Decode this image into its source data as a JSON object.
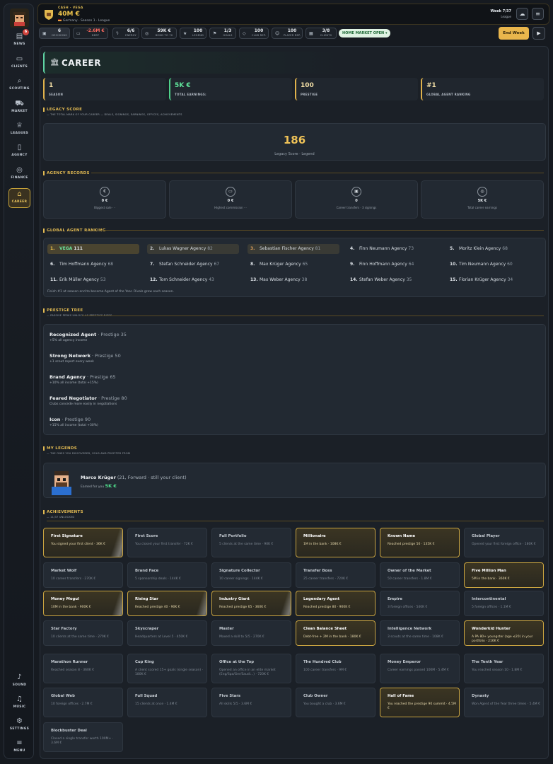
{
  "sidebar": {
    "items": [
      {
        "label": "NEWS",
        "icon": "newspaper-icon",
        "badge": "6"
      },
      {
        "label": "CLIENTS",
        "icon": "briefcase-icon"
      },
      {
        "label": "SCOUTING",
        "icon": "search-icon"
      },
      {
        "label": "MARKET",
        "icon": "cart-icon"
      },
      {
        "label": "LEAGUES",
        "icon": "trophy-icon"
      },
      {
        "label": "AGENCY",
        "icon": "document-icon"
      },
      {
        "label": "FINANCE",
        "icon": "coins-icon"
      },
      {
        "label": "CAREER",
        "icon": "bank-icon"
      }
    ],
    "bottom": [
      {
        "label": "SOUND",
        "icon": "speaker-icon"
      },
      {
        "label": "MUSIC",
        "icon": "music-icon"
      },
      {
        "label": "SETTINGS",
        "icon": "gear-icon"
      },
      {
        "label": "MENU",
        "icon": "menu-icon"
      }
    ]
  },
  "topbar": {
    "cash_label": "CASH · VEGA",
    "cash": "40M €",
    "sub": "Germany · Season 1 · League",
    "week": "Week 7/37",
    "week_sub": "League"
  },
  "stats": [
    {
      "value": "6",
      "label": "DECISIONS",
      "icon": "inbox-icon"
    },
    {
      "value": "-2.6M €",
      "label": "DEBT",
      "icon": "wallet-icon"
    },
    {
      "value": "6/6",
      "label": "ENERGY",
      "icon": "bolt-icon"
    },
    {
      "value": "59K €",
      "label": "BOND TO 70",
      "icon": "target-icon"
    },
    {
      "value": "100",
      "label": "LEGEND",
      "icon": "star-icon"
    },
    {
      "value": "1/3",
      "label": "GOALS",
      "icon": "flag-icon"
    },
    {
      "value": "100",
      "label": "CLUB REP.",
      "icon": "shield-icon"
    },
    {
      "value": "100",
      "label": "PLAYER REP.",
      "icon": "person-icon"
    },
    {
      "value": "3/8",
      "label": "CLIENTS",
      "icon": "clients-icon"
    }
  ],
  "market_pill": "HOME MARKET OPEN ▾",
  "end_week": "End Week",
  "career": {
    "title": "CAREER",
    "cards": [
      {
        "value": "1",
        "label": "SEASON"
      },
      {
        "value": "5K €",
        "label": "TOTAL EARNINGS:"
      },
      {
        "value": "100",
        "label": "PRESTIGE"
      },
      {
        "value": "#1",
        "label": "GLOBAL AGENT RANKING"
      }
    ],
    "legacy": {
      "title": "LEGACY SCORE",
      "subtitle": "— THE TOTAL MARK OF YOUR CAREER — DEALS, SIGNINGS, EARNINGS, OFFICES, ACHIEVEMENTS",
      "value": "186",
      "label": "Legacy Score · Legend"
    },
    "records": {
      "title": "AGENCY RECORDS",
      "items": [
        {
          "value": "0 €",
          "label": "Biggest sale · -",
          "icon": "€"
        },
        {
          "value": "0 €",
          "label": "Highest commission · -",
          "icon": "▭"
        },
        {
          "value": "0",
          "label": "Career transfers · 3 signings",
          "icon": "▣"
        },
        {
          "value": "5K €",
          "label": "Total career earnings",
          "icon": "◎"
        }
      ]
    },
    "ranking": {
      "title": "GLOBAL AGENT RANKING",
      "note": "Finish #1 at season end to become Agent of the Year. Rivals grow each season.",
      "rows": [
        [
          {
            "rank": "1.",
            "name": "VEGA",
            "score": "111"
          },
          {
            "rank": "2.",
            "name": "Lukas Wagner Agency",
            "score": "82"
          },
          {
            "rank": "3.",
            "name": "Sebastian Fischer Agency",
            "score": "81"
          },
          {
            "rank": "4.",
            "name": "Finn Neumann Agency",
            "score": "73"
          },
          {
            "rank": "5.",
            "name": "Moritz Klein Agency",
            "score": "68"
          }
        ],
        [
          {
            "rank": "6.",
            "name": "Tim Hoffmann Agency",
            "score": "68"
          },
          {
            "rank": "7.",
            "name": "Stefan Schneider Agency",
            "score": "67"
          },
          {
            "rank": "8.",
            "name": "Max Krüger Agency",
            "score": "65"
          },
          {
            "rank": "9.",
            "name": "Finn Hoffmann Agency",
            "score": "64"
          },
          {
            "rank": "10.",
            "name": "Tim Neumann Agency",
            "score": "60"
          }
        ],
        [
          {
            "rank": "11.",
            "name": "Erik Müller Agency",
            "score": "53"
          },
          {
            "rank": "12.",
            "name": "Tom Schneider Agency",
            "score": "43"
          },
          {
            "rank": "13.",
            "name": "Max Weber Agency",
            "score": "38"
          },
          {
            "rank": "14.",
            "name": "Stefan Weber Agency",
            "score": "35"
          },
          {
            "rank": "15.",
            "name": "Florian Krüger Agency",
            "score": "34"
          }
        ]
      ]
    },
    "prestige": {
      "title": "PRESTIGE TREE",
      "subtitle": "— PASSIVE PERKS UNLOCK AS PRESTIGE RISES",
      "tiers": [
        {
          "name": "Recognized Agent",
          "req": " · Prestige 35",
          "perk": "+5% all agency income"
        },
        {
          "name": "Strong Network",
          "req": " · Prestige 50",
          "perk": "+1 scout report every week"
        },
        {
          "name": "Brand Agency",
          "req": " · Prestige 65",
          "perk": "+10% all income (total +15%)"
        },
        {
          "name": "Feared Negotiator",
          "req": " · Prestige 80",
          "perk": "Clubs concede more easily in negotiations"
        },
        {
          "name": "Icon",
          "req": " · Prestige 90",
          "perk": "+15% all income (total +30%)"
        }
      ]
    },
    "legends": {
      "title": "MY LEGENDS",
      "subtitle": "— THE ONES YOU DISCOVERED, SOLD AND PROFITED FROM",
      "name": "Marco Krüger",
      "detail": " (21, Forward · still your client)",
      "earned_label": "Earned for you",
      "earned": "5K €"
    },
    "achievements": {
      "title": "ACHIEVEMENTS",
      "subtitle": "— 11/37 UNLOCKED",
      "items": [
        {
          "t": "First Signature",
          "d": "You signed your first client · 36K €",
          "on": true,
          "shine": true
        },
        {
          "t": "First Score",
          "d": "You closed your first transfer · 72K €",
          "on": false
        },
        {
          "t": "Full Portfolio",
          "d": "5 clients at the same time · 90K €",
          "on": false
        },
        {
          "t": "Millionaire",
          "d": "1M in the bank · 108K €",
          "on": true
        },
        {
          "t": "Known Name",
          "d": "Reached prestige 50 · 135K €",
          "on": true
        },
        {
          "t": "Global Player",
          "d": "Opened your first foreign office · 180K €",
          "on": false
        },
        {
          "t": "Market Wolf",
          "d": "10 career transfers · 270K €",
          "on": false
        },
        {
          "t": "Brand Face",
          "d": "5 sponsorship deals · 144K €",
          "on": false
        },
        {
          "t": "Signature Collector",
          "d": "10 career signings · 144K €",
          "on": false
        },
        {
          "t": "Transfer Boss",
          "d": "25 career transfers · 720K €",
          "on": false
        },
        {
          "t": "Owner of the Market",
          "d": "50 career transfers · 1.8M €",
          "on": false
        },
        {
          "t": "Five Million Man",
          "d": "5M in the bank · 360K €",
          "on": true
        },
        {
          "t": "Money Mogul",
          "d": "10M in the bank · 900K €",
          "on": true,
          "shine": true
        },
        {
          "t": "Rising Star",
          "d": "Reached prestige 40 · 90K €",
          "on": true,
          "shine": true
        },
        {
          "t": "Industry Giant",
          "d": "Reached prestige 65 · 360K €",
          "on": true,
          "shine": true
        },
        {
          "t": "Legendary Agent",
          "d": "Reached prestige 80 · 900K €",
          "on": true
        },
        {
          "t": "Empire",
          "d": "3 foreign offices · 540K €",
          "on": false
        },
        {
          "t": "Intercontinental",
          "d": "5 foreign offices · 1.1M €",
          "on": false
        },
        {
          "t": "Star Factory",
          "d": "10 clients at the same time · 270K €",
          "on": false
        },
        {
          "t": "Skyscraper",
          "d": "Headquarters at Level 5 · 450K €",
          "on": false
        },
        {
          "t": "Master",
          "d": "Maxed a skill to 5/5 · 270K €",
          "on": false
        },
        {
          "t": "Clean Balance Sheet",
          "d": "Debt-free + 2M in the bank · 180K €",
          "on": true
        },
        {
          "t": "Intelligence Network",
          "d": "3 scouts at the same time · 108K €",
          "on": false
        },
        {
          "t": "Wonderkid Hunter",
          "d": "A PA 80+ youngster (age ≤20) in your portfolio · 216K €",
          "on": true
        },
        {
          "t": "Marathon Runner",
          "d": "Reached season 8 · 360K €",
          "on": false
        },
        {
          "t": "Cup King",
          "d": "A client scored 15+ goals (single season) · 180K €",
          "on": false
        },
        {
          "t": "Office at the Top",
          "d": "Opened an office in an elite market (Eng/Spa/Ger/Saudi...) · 720K €",
          "on": false
        },
        {
          "t": "The Hundred Club",
          "d": "100 career transfers · 9M €",
          "on": false
        },
        {
          "t": "Money Emperor",
          "d": "Career earnings passed 100M · 5.4M €",
          "on": false
        },
        {
          "t": "The Tenth Year",
          "d": "You reached season 10 · 1.8M €",
          "on": false
        },
        {
          "t": "Global Web",
          "d": "10 foreign offices · 2.7M €",
          "on": false
        },
        {
          "t": "Full Squad",
          "d": "15 clients at once · 1.4M €",
          "on": false
        },
        {
          "t": "Five Stars",
          "d": "All skills 5/5 · 3.6M €",
          "on": false
        },
        {
          "t": "Club Owner",
          "d": "You bought a club · 3.6M €",
          "on": false
        },
        {
          "t": "Hall of Fame",
          "d": "You reached the prestige 90 summit · 4.5M €",
          "on": true
        },
        {
          "t": "Dynasty",
          "d": "Won Agent of the Year three times · 5.4M €",
          "on": false
        },
        {
          "t": "Blockbuster Deal",
          "d": "Closed a single transfer worth 100M+ · 3.6M €",
          "on": false
        }
      ]
    }
  }
}
